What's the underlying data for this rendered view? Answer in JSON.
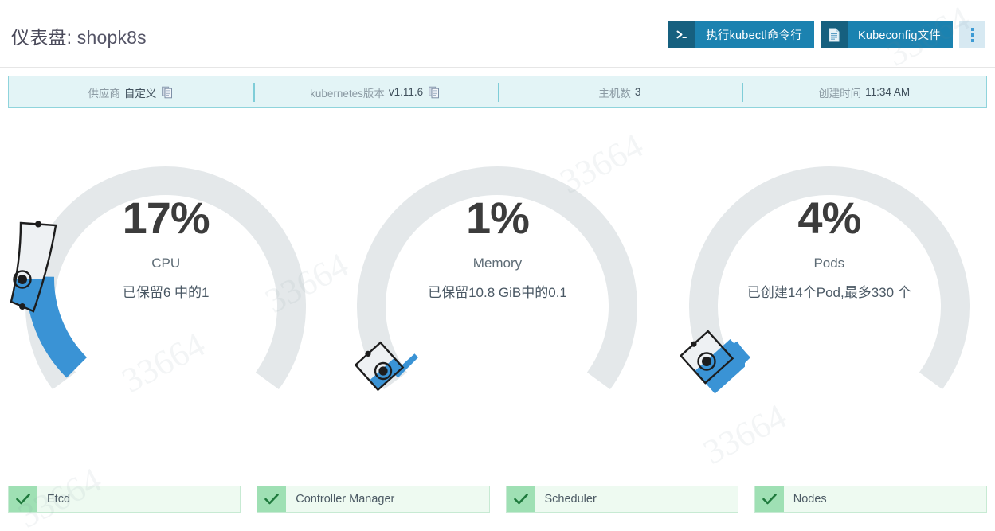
{
  "header": {
    "title_prefix": "仪表盘:",
    "title_name": "shopk8s",
    "actions": [
      {
        "icon": "terminal-icon",
        "label": "执行kubectl命令行"
      },
      {
        "icon": "file-document-icon",
        "label": "Kubeconfig文件"
      }
    ],
    "overflow_menu": "kebab-menu-icon"
  },
  "info_bar": [
    {
      "key": "供应商",
      "value": "自定义",
      "copy": true,
      "name": "provider"
    },
    {
      "key": "kubernetes版本",
      "value": "v1.11.6",
      "copy": true,
      "name": "kubernetes-version"
    },
    {
      "key": "主机数",
      "value": "3",
      "copy": false,
      "name": "host-count"
    },
    {
      "key": "创建时间",
      "value": "11:34 AM",
      "copy": false,
      "name": "created-time"
    }
  ],
  "gauges": [
    {
      "name": "CPU",
      "percent": "17%",
      "value": 17,
      "subtitle": "已保留6 中的1",
      "handle": "cpu"
    },
    {
      "name": "Memory",
      "percent": "1%",
      "value": 1,
      "subtitle": "已保留10.8 GiB中的0.1",
      "handle": "memory"
    },
    {
      "name": "Pods",
      "percent": "4%",
      "value": 4,
      "subtitle": "已创建14个Pod,最多330 个",
      "handle": "pods"
    }
  ],
  "components": [
    {
      "label": "Etcd",
      "status": "healthy",
      "icon": "check-icon"
    },
    {
      "label": "Controller Manager",
      "status": "healthy",
      "icon": "check-icon"
    },
    {
      "label": "Scheduler",
      "status": "healthy",
      "icon": "check-icon"
    },
    {
      "label": "Nodes",
      "status": "healthy",
      "icon": "check-icon"
    }
  ],
  "colors": {
    "accent_blue": "#3a93d5",
    "button_blue": "#1b82b0",
    "button_icon_blue": "#16607f",
    "track_gray": "#e4e8ea",
    "info_bg": "#e3f4f6",
    "info_border": "#8fd4dc",
    "status_green": "#9fe0b4",
    "status_bg": "#eefaf1"
  },
  "watermark": "33664"
}
